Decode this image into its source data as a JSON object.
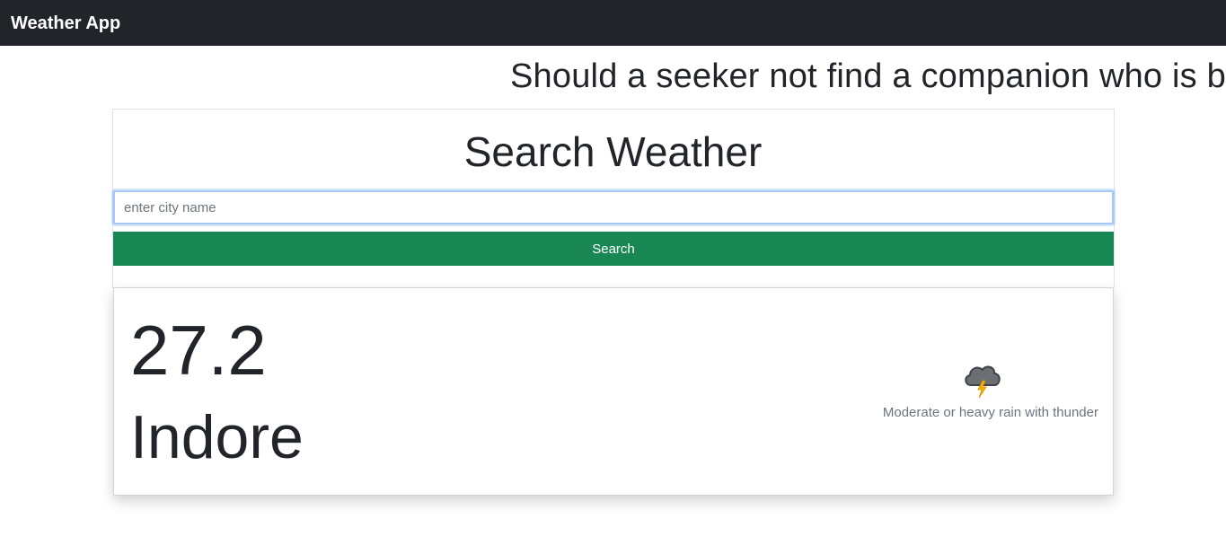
{
  "navbar": {
    "brand": "Weather App"
  },
  "marquee": {
    "text": "Should a seeker not find a companion who is be"
  },
  "search": {
    "title": "Search Weather",
    "placeholder": "enter city name",
    "value": "",
    "button_label": "Search",
    "button_color": "#198754"
  },
  "weather": {
    "temperature": "27.2",
    "city": "Indore",
    "condition": "Moderate or heavy rain with thunder",
    "condition_icon": "thunder-cloud-icon"
  },
  "colors": {
    "navbar_bg": "#212529",
    "accent": "#198754"
  }
}
